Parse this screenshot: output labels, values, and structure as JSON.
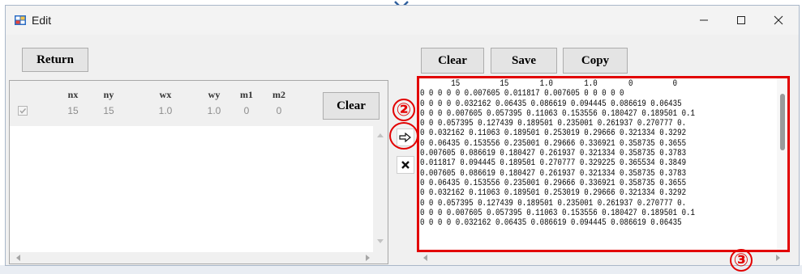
{
  "window": {
    "title": "Edit",
    "controls": {
      "minimize_icon": "minimize-icon",
      "maximize_icon": "maximize-icon",
      "close_icon": "close-icon"
    }
  },
  "left": {
    "return_label": "Return",
    "clear_label": "Clear",
    "headers": [
      "nx",
      "ny",
      "wx",
      "wy",
      "m1",
      "m2"
    ],
    "values": [
      "15",
      "15",
      "1.0",
      "1.0",
      "0",
      "0"
    ],
    "checked": true
  },
  "middle": {
    "copy_arrow_icon": "right-arrow-icon",
    "delete_icon": "x-icon"
  },
  "right": {
    "clear_label": "Clear",
    "save_label": "Save",
    "copy_label": "Copy",
    "text": "       15         15       1.0       1.0       0         0\n0 0 0 0 0 0.007605 0.011817 0.007605 0 0 0 0 0\n0 0 0 0 0.032162 0.06435 0.086619 0.094445 0.086619 0.06435\n0 0 0 0.007605 0.057395 0.11063 0.153556 0.180427 0.189501 0.1\n0 0 0.057395 0.127439 0.189501 0.235001 0.261937 0.270777 0.\n0 0.032162 0.11063 0.189501 0.253019 0.29666 0.321334 0.3292\n0 0.06435 0.153556 0.235001 0.29666 0.336921 0.358735 0.3655\n0.007605 0.086619 0.180427 0.261937 0.321334 0.358735 0.3783\n0.011817 0.094445 0.189501 0.270777 0.329225 0.365534 0.3849\n0.007605 0.086619 0.180427 0.261937 0.321334 0.358735 0.3783\n0 0.06435 0.153556 0.235001 0.29666 0.336921 0.358735 0.3655\n0 0.032162 0.11063 0.189501 0.253019 0.29666 0.321334 0.3292\n0 0 0.057395 0.127439 0.189501 0.235001 0.261937 0.270777 0.\n0 0 0 0.007605 0.057395 0.11063 0.153556 0.180427 0.189501 0.1\n0 0 0 0 0.032162 0.06435 0.086619 0.094445 0.086619 0.06435"
  },
  "annotations": {
    "callout_2": "②",
    "callout_3": "③",
    "color": "#e20000"
  }
}
